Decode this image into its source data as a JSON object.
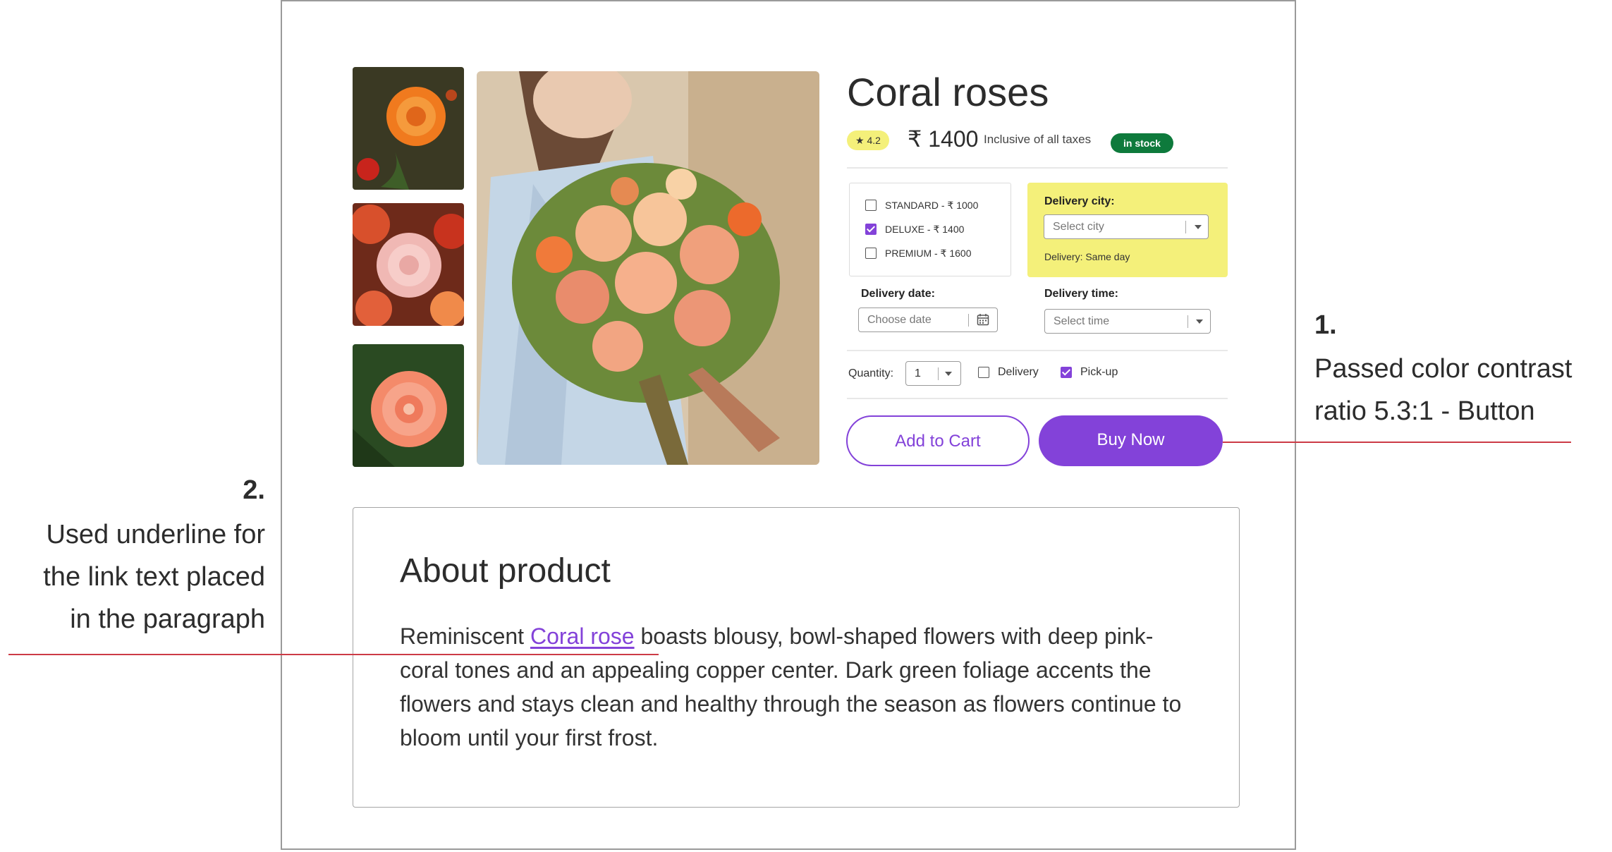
{
  "product": {
    "title": "Coral roses",
    "rating": "★ 4.2",
    "price": "₹ 1400",
    "tax_note": "Inclusive of all taxes",
    "stock_badge": "in stock"
  },
  "options": [
    {
      "label": "STANDARD - ₹ 1000",
      "checked": false
    },
    {
      "label": "DELUXE - ₹ 1400",
      "checked": true
    },
    {
      "label": "PREMIUM - ₹ 1600",
      "checked": false
    }
  ],
  "delivery_city": {
    "label": "Delivery city:",
    "placeholder": "Select city",
    "note": "Delivery: Same day"
  },
  "delivery_date": {
    "label": "Delivery date:",
    "placeholder": "Choose date"
  },
  "delivery_time": {
    "label": "Delivery time:",
    "placeholder": "Select time"
  },
  "quantity": {
    "label": "Quantity:",
    "value": "1"
  },
  "fulfilment": {
    "delivery_label": "Delivery",
    "delivery_checked": false,
    "pickup_label": "Pick-up",
    "pickup_checked": true
  },
  "buttons": {
    "add_to_cart": "Add to Cart",
    "buy_now": "Buy Now"
  },
  "about": {
    "title": "About product",
    "text_before": "Reminiscent ",
    "link": "Coral rose",
    "text_after": " boasts blousy, bowl-shaped flowers with deep pink-coral tones and an appealing copper center. Dark green foliage accents the flowers and stays clean and healthy through the season as flowers continue to bloom until your first frost."
  },
  "annotations": {
    "note1_num": "1.",
    "note1_line1": "Passed color contrast",
    "note1_line2": "ratio 5.3:1 - Button",
    "note2_num": "2.",
    "note2_line1": "Used underline for",
    "note2_line2": "the link text placed",
    "note2_line3": "in the paragraph"
  },
  "colors": {
    "accent": "#8342d9",
    "highlight": "#f4f07a",
    "stock": "#0e7a3c",
    "annotation_line": "#cc3b46"
  },
  "icons": [
    "star-icon",
    "calendar-icon",
    "chevron-down-icon",
    "checkbox-icon"
  ]
}
